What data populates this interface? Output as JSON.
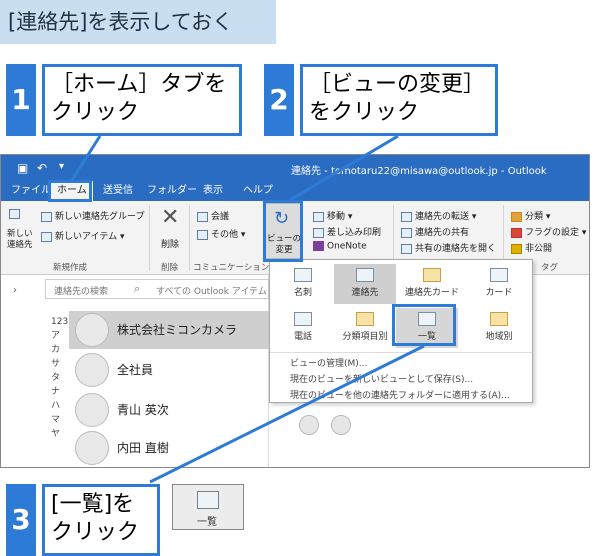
{
  "banner": {
    "title": "[連絡先]を表示しておく"
  },
  "steps": [
    {
      "num": "1",
      "line1": "［ホーム］タブを",
      "line2": "クリック"
    },
    {
      "num": "2",
      "line1": "［ビューの変更］",
      "line2": "をクリック"
    },
    {
      "num": "3",
      "line1": "[一覧]を",
      "line2": "クリック"
    }
  ],
  "outlook": {
    "window_title": "連絡先 - tomotaru22@misawa@outlook.jp - Outlook",
    "tabs": [
      "ファイル",
      "ホーム",
      "送受信",
      "フォルダー",
      "表示",
      "ヘルプ"
    ],
    "ribbon": {
      "new_contact": "新しい連絡先",
      "new_group": "新しい連絡先グループ",
      "new_items": "新しいアイテム",
      "delete": "削除",
      "meeting": "会議",
      "other": "その他",
      "change_view": "ビューの変更",
      "move": "移動",
      "mailmerge": "差し込み印刷",
      "onenote": "OneNote",
      "forward": "連絡先の転送",
      "share": "連絡先の共有",
      "open_shared": "共有の連絡先を開く",
      "categorize": "分類",
      "followup": "フラグの設定",
      "private": "非公開",
      "group_new": "新規作成",
      "group_delete": "削除",
      "group_comm": "コミュニケーション",
      "group_tags": "タグ"
    },
    "search": {
      "placeholder": "連絡先の検索",
      "scope": "すべての Outlook アイテム"
    },
    "alpha_index": [
      "123",
      "ア",
      "カ",
      "サ",
      "タ",
      "ナ",
      "ハ",
      "マ",
      "ヤ"
    ],
    "contacts": [
      {
        "name": "株式会社ミコンカメラ"
      },
      {
        "name": "全社員"
      },
      {
        "name": "青山 英次"
      },
      {
        "name": "内田 直樹"
      }
    ],
    "views": [
      {
        "label": "名刺"
      },
      {
        "label": "連絡先"
      },
      {
        "label": "連絡先カード"
      },
      {
        "label": "カード"
      },
      {
        "label": "電話"
      },
      {
        "label": "分類項目別"
      },
      {
        "label": "一覧"
      },
      {
        "label": "地域別"
      }
    ],
    "menu": [
      "ビューの管理(M)...",
      "現在のビューを新しいビューとして保存(S)...",
      "現在のビューを他の連絡先フォルダーに適用する(A)..."
    ]
  },
  "list_icon": {
    "label": "一覧"
  }
}
